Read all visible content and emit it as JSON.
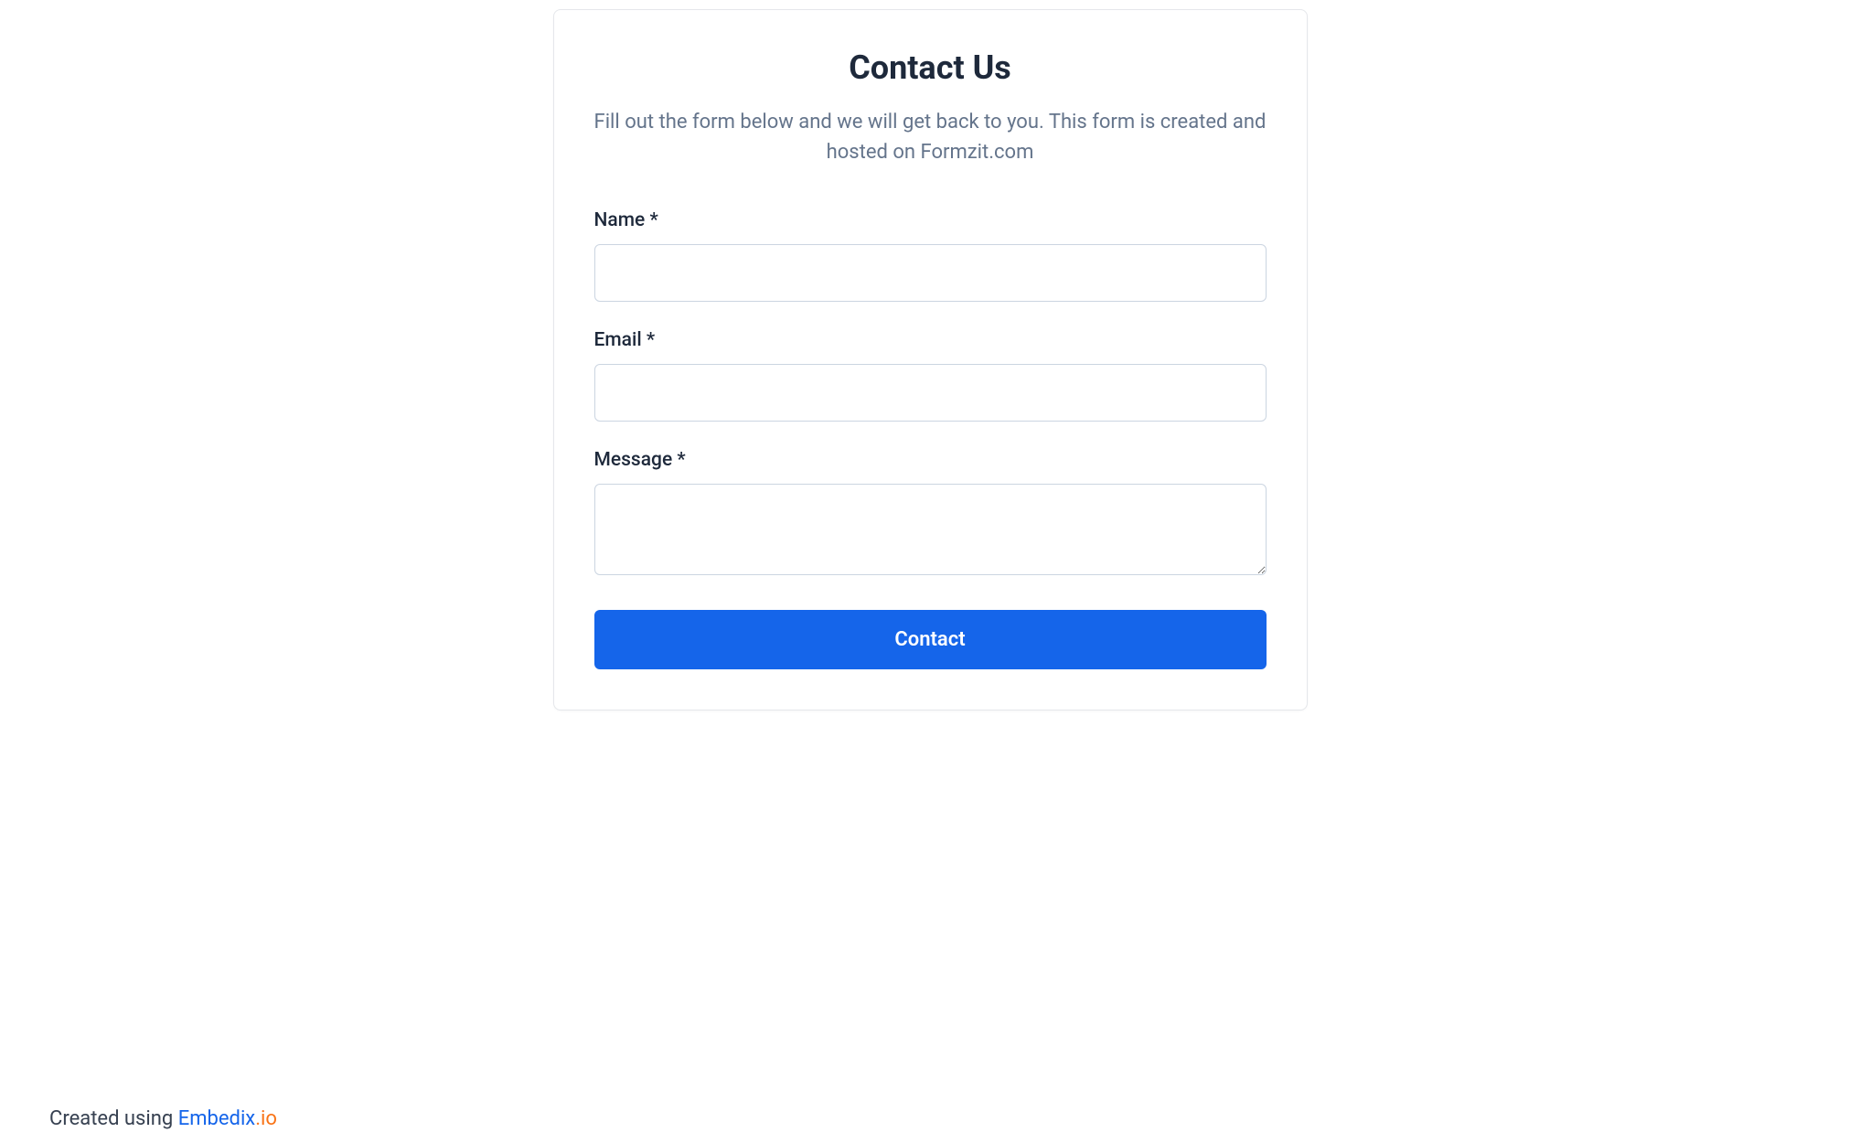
{
  "form": {
    "title": "Contact Us",
    "subtitle": "Fill out the form below and we will get back to you. This form is created and hosted on Formzit.com",
    "fields": {
      "name": {
        "label": "Name *",
        "value": ""
      },
      "email": {
        "label": "Email *",
        "value": ""
      },
      "message": {
        "label": "Message *",
        "value": ""
      }
    },
    "submit_label": "Contact"
  },
  "footer": {
    "prefix": "Created using ",
    "brand": "Embedix",
    "tld": ".io"
  }
}
